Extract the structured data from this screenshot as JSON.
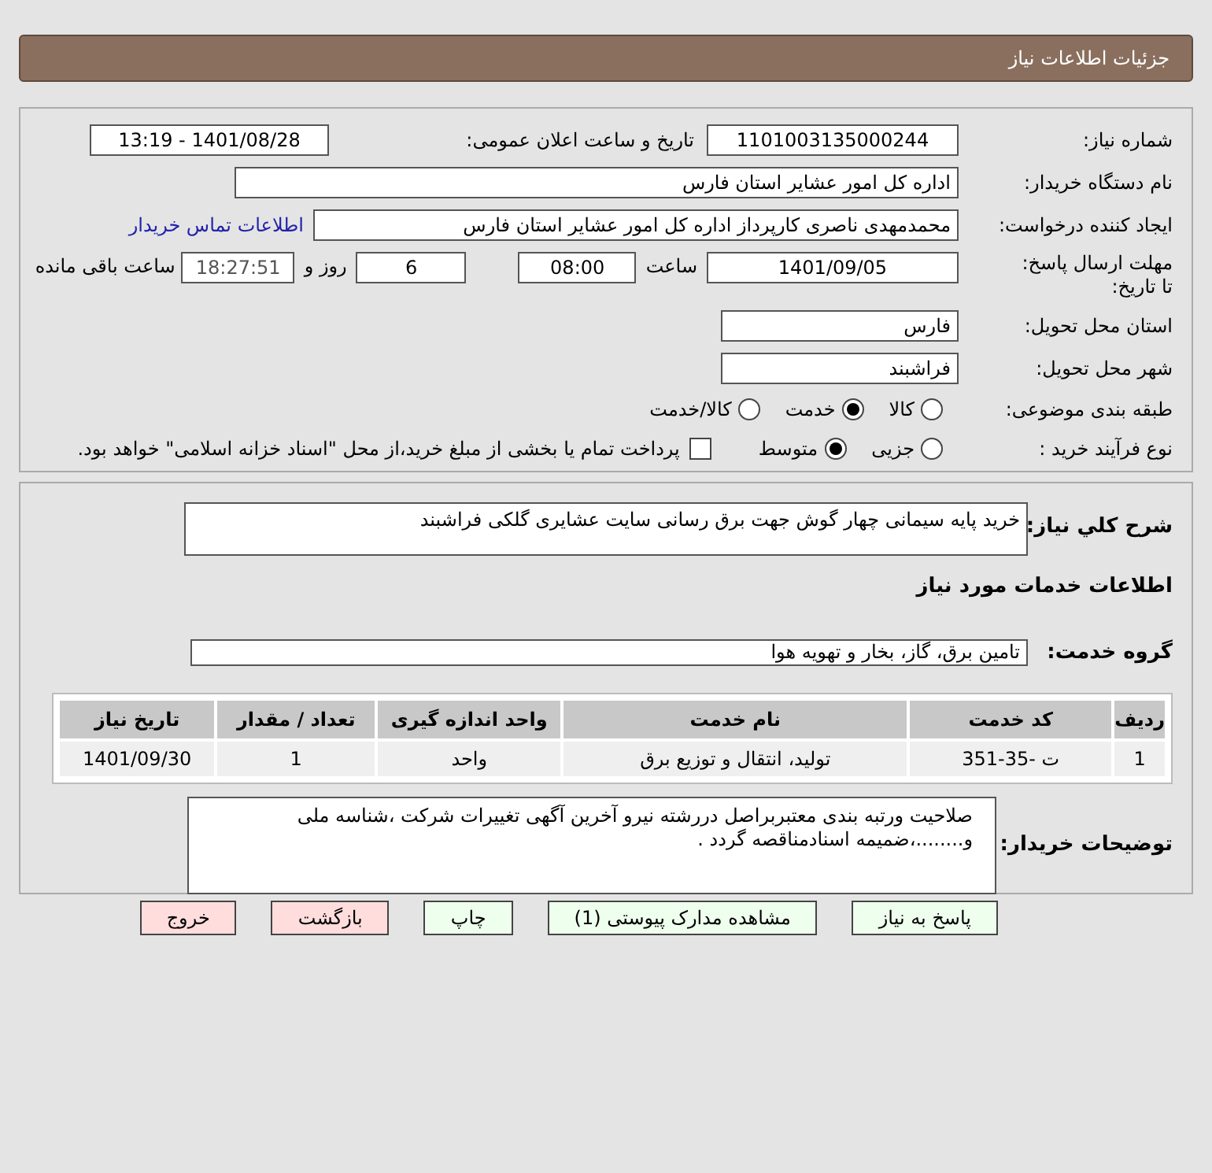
{
  "header": {
    "title": "جزئیات اطلاعات نیاز"
  },
  "need_info": {
    "need_number": {
      "label": "شماره نیاز:",
      "value": "1101003135000244"
    },
    "announce": {
      "label": "تاریخ و ساعت اعلان عمومی:",
      "value": "1401/08/28 - 13:19"
    },
    "buyer_org": {
      "label": "نام دستگاه خریدار:",
      "value": "اداره کل امور عشایر استان فارس"
    },
    "requester": {
      "label": "ایجاد کننده درخواست:",
      "value": "محمدمهدی ناصری کارپرداز اداره کل امور عشایر استان فارس",
      "link": "اطلاعات تماس خریدار"
    },
    "deadline": {
      "label": "مهلت ارسال پاسخ: تا تاریخ:",
      "date": "1401/09/05",
      "time_label": "ساعت",
      "time": "08:00",
      "days": "6",
      "days_label": "روز و",
      "remaining": "18:27:51",
      "remaining_label": "ساعت باقی مانده"
    },
    "province": {
      "label": "استان محل تحویل:",
      "value": "فارس"
    },
    "city": {
      "label": "شهر محل تحویل:",
      "value": "فراشبند"
    },
    "category": {
      "label": "طبقه بندی موضوعی:",
      "options": [
        {
          "label": "کالا",
          "selected": false
        },
        {
          "label": "خدمت",
          "selected": true
        },
        {
          "label": "کالا/خدمت",
          "selected": false
        }
      ]
    },
    "process": {
      "label": "نوع فرآیند خرید :",
      "options": [
        {
          "label": "جزیی",
          "selected": false
        },
        {
          "label": "متوسط",
          "selected": true
        }
      ],
      "payment": {
        "checked": false,
        "text": "پرداخت تمام یا بخشی از مبلغ خرید،از محل \"اسناد خزانه اسلامی\" خواهد بود."
      }
    }
  },
  "services": {
    "description": {
      "label": "شرح کلي نياز:",
      "value": "خرید پایه سیمانی چهار گوش جهت برق رسانی سایت عشایری گلکی فراشبند"
    },
    "heading": "اطلاعات خدمات مورد نیاز",
    "group": {
      "label": "گروه خدمت:",
      "value": "تامین برق، گاز، بخار و تهویه هوا"
    },
    "table": {
      "columns": [
        "ردیف",
        "کد خدمت",
        "نام خدمت",
        "واحد اندازه گیری",
        "تعداد / مقدار",
        "تاریخ نیاز"
      ],
      "rows": [
        [
          "1",
          "ت -35-351",
          "تولید، انتقال و توزیع برق",
          "واحد",
          "1",
          "1401/09/30"
        ]
      ]
    },
    "buyer_notes": {
      "label": "توضیحات خریدار:",
      "value": "صلاحیت ورتبه بندی معتبربراصل دررشته نیرو آخرین آگهی تغییرات شرکت ،شناسه ملی و........،ضمیمه اسنادمناقصه گردد ."
    }
  },
  "buttons": [
    {
      "label": "پاسخ به نیاز",
      "kind": "action"
    },
    {
      "label": "مشاهده مدارک پیوستی (1)",
      "kind": "action"
    },
    {
      "label": "چاپ",
      "kind": "action"
    },
    {
      "label": "بازگشت",
      "kind": "exit"
    },
    {
      "label": "خروج",
      "kind": "exit"
    }
  ]
}
